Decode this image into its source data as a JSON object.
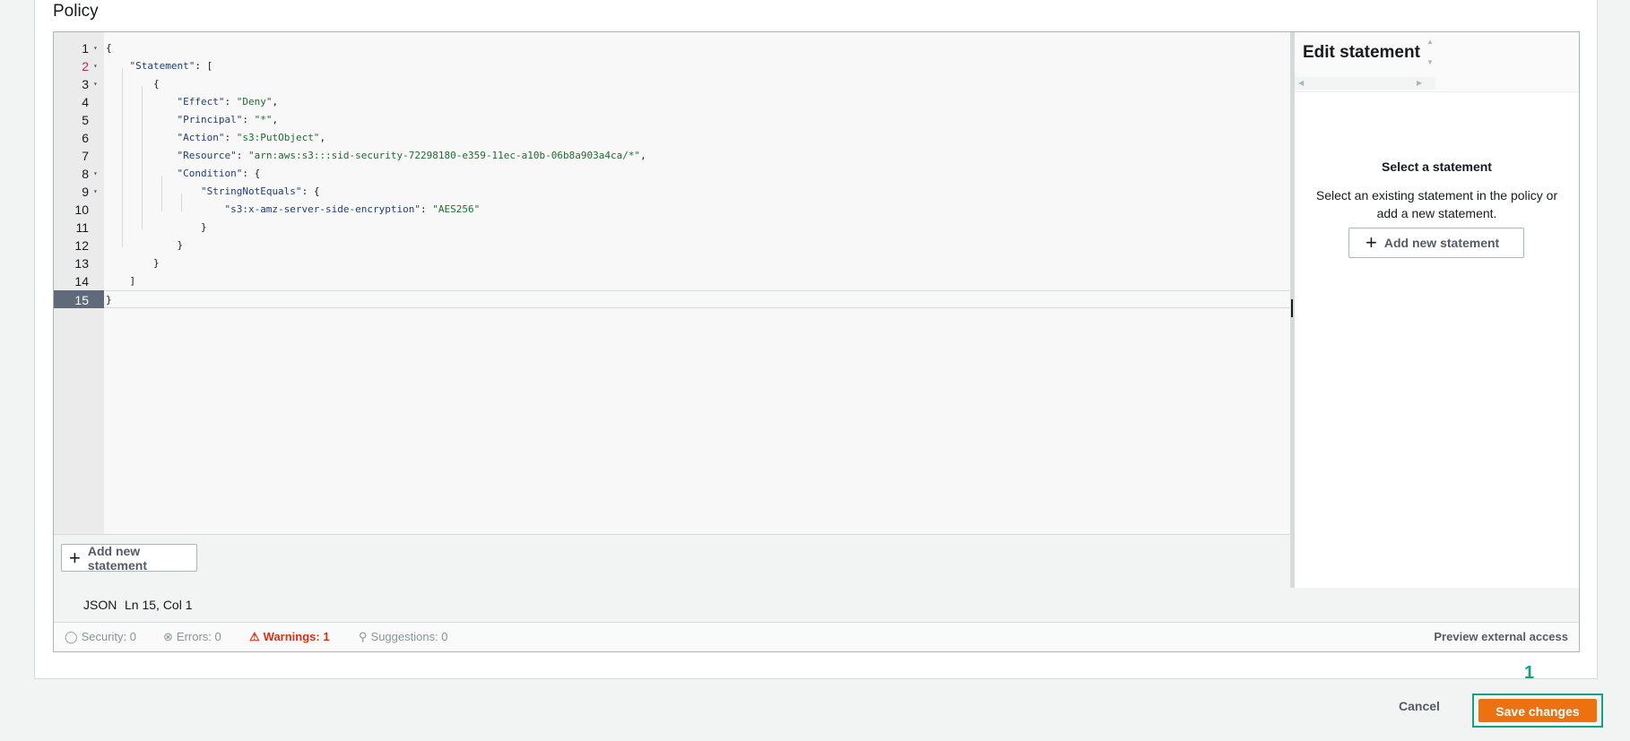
{
  "policy_title": "Policy",
  "editor": {
    "lines": [
      {
        "n": "1",
        "text": "{"
      },
      {
        "n": "2",
        "text": "    \"Statement\": ["
      },
      {
        "n": "3",
        "text": "        {"
      },
      {
        "n": "4",
        "text": "            \"Effect\": \"Deny\","
      },
      {
        "n": "5",
        "text": "            \"Principal\": \"*\","
      },
      {
        "n": "6",
        "text": "            \"Action\": \"s3:PutObject\","
      },
      {
        "n": "7",
        "text": "            \"Resource\": \"arn:aws:s3:::sid-security-72298180-e359-11ec-a10b-06b8a903a4ca/*\","
      },
      {
        "n": "8",
        "text": "            \"Condition\": {"
      },
      {
        "n": "9",
        "text": "                \"StringNotEquals\": {"
      },
      {
        "n": "10",
        "text": "                    \"s3:x-amz-server-side-encryption\": \"AES256\""
      },
      {
        "n": "11",
        "text": "                }"
      },
      {
        "n": "12",
        "text": "            }"
      },
      {
        "n": "13",
        "text": "        }"
      },
      {
        "n": "14",
        "text": "    ]"
      },
      {
        "n": "15",
        "text": "}"
      }
    ],
    "add_statement_label": "Add new statement"
  },
  "side_panel": {
    "title": "Edit statement",
    "empty_title": "Select a statement",
    "empty_text": "Select an existing statement in the policy or add a new statement.",
    "add_statement_label": "Add new statement"
  },
  "status": {
    "language": "JSON",
    "cursor": "Ln 15, Col 1",
    "security": "Security: 0",
    "errors": "Errors: 0",
    "warnings": "Warnings: 1",
    "suggestions": "Suggestions: 0",
    "preview_external_access": "Preview external access"
  },
  "footer": {
    "cancel_label": "Cancel",
    "save_label": "Save changes",
    "step_number": "1"
  },
  "colors": {
    "primary_button": "#ec7211",
    "highlight": "#16a085",
    "warning": "#d13212"
  }
}
